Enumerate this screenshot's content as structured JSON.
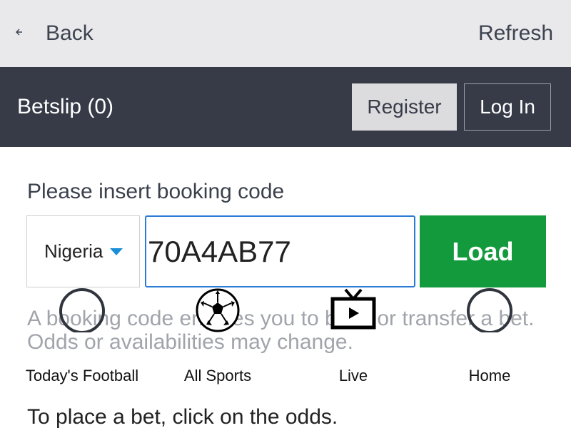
{
  "topbar": {
    "back_label": "Back",
    "back_icon": "arrow-left-icon",
    "refresh_label": "Refresh"
  },
  "header": {
    "betslip_label": "Betslip (0)",
    "register_label": "Register",
    "login_label": "Log In"
  },
  "booking": {
    "prompt": "Please insert booking code",
    "country_selected": "Nigeria",
    "code_value": "70A4AB77",
    "load_label": "Load",
    "info_text": "A booking code enables you to book or transfer a bet. Odds or availabilities may change."
  },
  "bottom_nav": {
    "items": [
      {
        "label": "Today's Football",
        "icon": "circle-icon"
      },
      {
        "label": "All Sports",
        "icon": "soccer-ball-icon"
      },
      {
        "label": "Live",
        "icon": "tv-play-icon"
      },
      {
        "label": "Home",
        "icon": "circle-icon"
      }
    ]
  },
  "hint": "To place a bet, click on the odds.",
  "colors": {
    "header_bg": "#363b47",
    "load_green": "#129a3c",
    "input_border": "#2b7bd6",
    "caret_blue": "#1a8fd6"
  }
}
